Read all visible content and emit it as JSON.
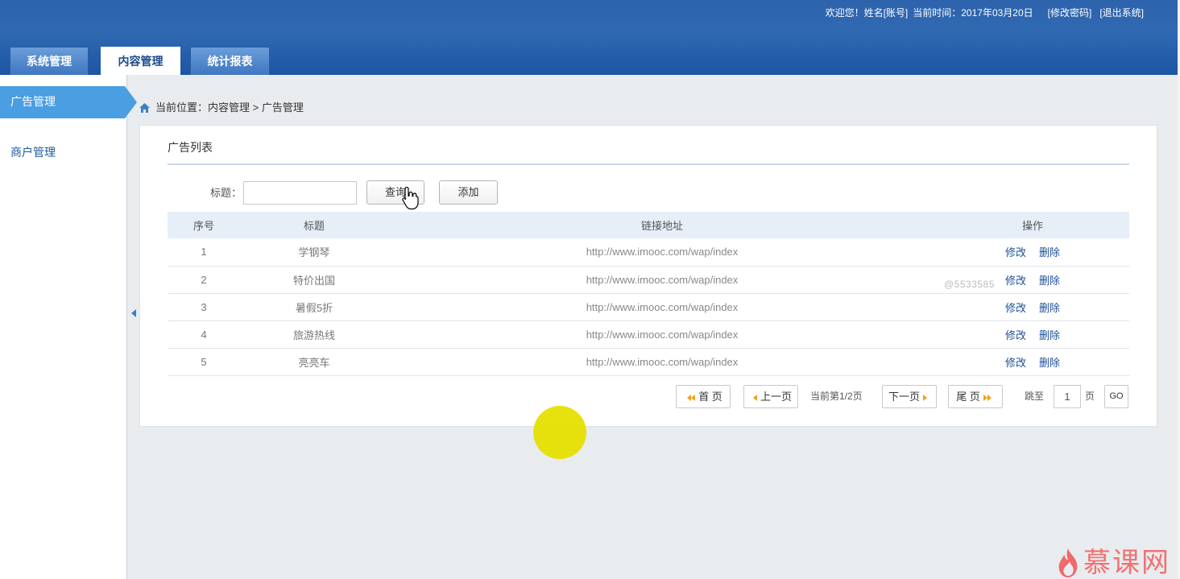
{
  "header": {
    "welcome": "欢迎您！姓名[账号]",
    "current_time": "当前时间：2017年03月20日",
    "change_password": "[修改密码]",
    "logout": "[退出系统]",
    "tabs": [
      {
        "label": "系统管理",
        "active": false
      },
      {
        "label": "内容管理",
        "active": true
      },
      {
        "label": "统计报表",
        "active": false
      }
    ]
  },
  "sidebar": {
    "items": [
      {
        "label": "广告管理",
        "active": true
      },
      {
        "label": "商户管理",
        "active": false
      }
    ],
    "collapse_icon": "caret-left-icon"
  },
  "breadcrumb": {
    "icon": "home-icon",
    "text": "当前位置：内容管理 > 广告管理"
  },
  "panel": {
    "title": "广告列表"
  },
  "search": {
    "label": "标题：",
    "value": "",
    "query_button": "查询",
    "add_button": "添加"
  },
  "table": {
    "columns": [
      "序号",
      "标题",
      "链接地址",
      "操作"
    ],
    "actions": {
      "edit": "修改",
      "delete": "删除"
    },
    "rows": [
      {
        "no": "1",
        "title": "学钢琴",
        "url": "http://www.imooc.com/wap/index"
      },
      {
        "no": "2",
        "title": "特价出国",
        "url": "http://www.imooc.com/wap/index"
      },
      {
        "no": "3",
        "title": "暑假5折",
        "url": "http://www.imooc.com/wap/index"
      },
      {
        "no": "4",
        "title": "旅游热线",
        "url": "http://www.imooc.com/wap/index"
      },
      {
        "no": "5",
        "title": "亮亮车",
        "url": "http://www.imooc.com/wap/index"
      }
    ]
  },
  "pagination": {
    "first": "首 页",
    "prev": "上一页",
    "status": "当前第1/2页",
    "next": "下一页",
    "last": "尾 页",
    "jump_label": "跳至",
    "page_input": "1",
    "page_suffix": "页",
    "go": "GO",
    "arrow_icons": [
      "double-left-arrow-icon",
      "left-arrow-icon",
      "right-arrow-icon",
      "double-right-arrow-icon"
    ]
  },
  "overlay": {
    "watermark": "@5533585",
    "logo_text": "慕课网",
    "logo_icon": "flame-icon",
    "cursor_icon": "hand-pointer-icon",
    "click_highlight": "yellow-circle"
  },
  "colors": {
    "header": "#2a62ab",
    "sidebar_active": "#4a9ee2",
    "link": "#1d4f98",
    "table_header": "#e6eef8",
    "page_bg": "#e9ecef",
    "pager_arrow": "#f0a020",
    "highlight": "#e6e000",
    "logo": "#f07272",
    "nav_text": "#1d5b9e"
  }
}
